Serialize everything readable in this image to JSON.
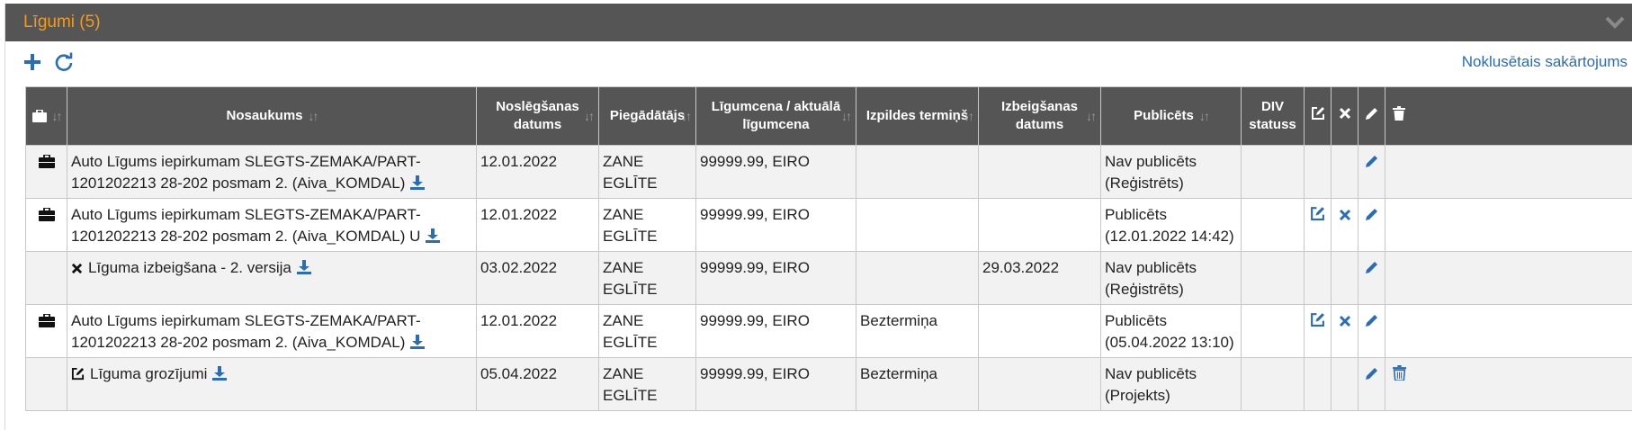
{
  "panel": {
    "title": "Līgumi (5)"
  },
  "toolbar": {
    "default_sort_label": "Noklusētais sakārtojums"
  },
  "columns": {
    "name": "Nosaukums",
    "signed_date": "Noslēgšanas datums",
    "supplier": "Piegādātājs",
    "price": "Līgumcena / aktuālā līgumcena",
    "term": "Izpildes termiņš",
    "end_date": "Izbeigšanas datums",
    "published": "Publicēts",
    "div_status": "DIV statuss"
  },
  "rows": [
    {
      "type_icon": "briefcase-icon",
      "name": "Auto Līgums iepirkumam SLEGTS-ZEMAKA/PART-1201202213 28-202 posmam 2. (Aiva_KOMDAL)",
      "signed_date": "12.01.2022",
      "supplier": "ZANE EGLĪTE",
      "price": "99999.99, EIRO",
      "term": "",
      "end_date": "",
      "published": "Nav publicēts (Reģistrēts)",
      "div_status": "",
      "actions": [
        "pencil"
      ]
    },
    {
      "type_icon": "briefcase-icon",
      "name": "Auto Līgums iepirkumam SLEGTS-ZEMAKA/PART-1201202213 28-202 posmam 2. (Aiva_KOMDAL) U",
      "signed_date": "12.01.2022",
      "supplier": "ZANE EGLĪTE",
      "price": "99999.99, EIRO",
      "term": "",
      "end_date": "",
      "published": "Publicēts (12.01.2022 14:42)",
      "div_status": "",
      "actions": [
        "edit-square",
        "close",
        "pencil"
      ]
    },
    {
      "type_icon": "",
      "name": "Līguma izbeigšana - 2. versija",
      "name_icon": "close-icon",
      "signed_date": "03.02.2022",
      "supplier": "ZANE EGLĪTE",
      "price": "99999.99, EIRO",
      "term": "",
      "end_date": "29.03.2022",
      "published": "Nav publicēts (Reģistrēts)",
      "div_status": "",
      "actions": [
        "pencil"
      ]
    },
    {
      "type_icon": "briefcase-icon",
      "name": "Auto Līgums iepirkumam SLEGTS-ZEMAKA/PART-1201202213 28-202 posmam 2. (Aiva_KOMDAL)",
      "signed_date": "12.01.2022",
      "supplier": "ZANE EGLĪTE",
      "price": "99999.99, EIRO",
      "term": "Beztermiņa",
      "end_date": "",
      "published": "Publicēts (05.04.2022 13:10)",
      "div_status": "",
      "actions": [
        "edit-square",
        "close",
        "pencil"
      ]
    },
    {
      "type_icon": "",
      "name": "Līguma grozījumi",
      "name_icon": "edit-square-icon",
      "signed_date": "05.04.2022",
      "supplier": "ZANE EGLĪTE",
      "price": "99999.99, EIRO",
      "term": "Beztermiņa",
      "end_date": "",
      "published": "Nav publicēts (Projekts)",
      "div_status": "",
      "actions": [
        "pencil",
        "trash"
      ]
    }
  ],
  "colors": {
    "accent": "#2a6db5",
    "header_bg": "#555555",
    "title": "#f39a1e"
  }
}
